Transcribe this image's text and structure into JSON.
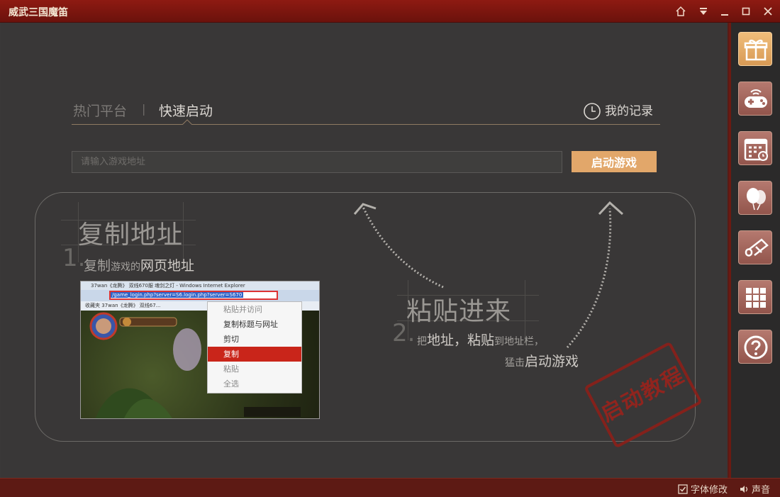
{
  "window": {
    "title": "威武三国魔笛"
  },
  "tabs": {
    "hot_platform": "热门平台",
    "separator": "|",
    "quick_start": "快速启动",
    "my_records": "我的记录"
  },
  "address": {
    "placeholder": "请输入游戏地址",
    "start_button": "启动游戏"
  },
  "tutorial": {
    "step1": {
      "title": "复制地址",
      "number": "1.",
      "desc_small1": "复制",
      "desc_small2": "游戏的",
      "desc_big": "网页地址"
    },
    "step2": {
      "title": "粘贴进来",
      "number": "2.",
      "line1_small1": "把",
      "line1_big1": "地址，粘贴",
      "line1_small2": "到地址栏，",
      "line2_small": "猛击",
      "line2_big": "启动游戏"
    },
    "stamp": "启动教程",
    "screenshot": {
      "window_title": "37wan《龙腾》 双线670服 魂剑之灯 - Windows Internet Explorer",
      "url": "/game_login.php?server=S6.login.php?server=S670",
      "favorites": "收藏夹   37wan《龙腾》 双线67...",
      "menu": [
        "粘贴并访问",
        "复制标题与网址",
        "剪切",
        "复制",
        "粘贴",
        "全选"
      ]
    }
  },
  "statusbar": {
    "font_change": "字体修改",
    "sound": "声音"
  },
  "colors": {
    "titlebar": "#7d160e",
    "accent_button": "#e2a76a",
    "sidebar_button": "#a5675e",
    "menu_highlight": "#c9251a"
  },
  "sidebar_icons": [
    "gift-icon",
    "gamepad-icon",
    "calendar-icon",
    "balloon-icon",
    "scroll-icon",
    "grid-icon",
    "help-icon"
  ]
}
